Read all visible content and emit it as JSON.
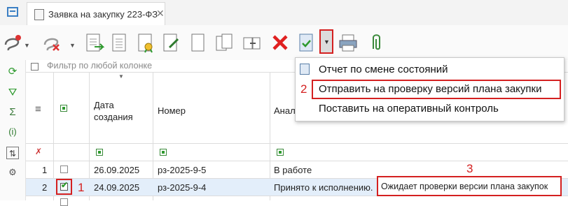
{
  "tab": {
    "title": "Заявка на закупку 223-ФЗ",
    "close": "✕"
  },
  "filter": {
    "placeholder": "Фильтр по любой колонке"
  },
  "columns": {
    "created_line1": "Дата",
    "created_line2": "создания",
    "number": "Номер",
    "analytics": "Анал"
  },
  "rows": [
    {
      "idx": "1",
      "checked": false,
      "date": "26.09.2025",
      "number": "рз-2025-9-5",
      "status": "В работе",
      "state": ""
    },
    {
      "idx": "2",
      "checked": true,
      "date": "24.09.2025",
      "number": "рз-2025-9-4",
      "status": "Принято к исполнению.",
      "state": "Ожидает проверки версии плана закупок"
    }
  ],
  "menu": {
    "items": [
      "Отчет по смене состояний",
      "Отправить на проверку версий плана закупки",
      "Поставить на оперативный контроль"
    ]
  },
  "annotations": {
    "n1": "1",
    "n2": "2",
    "n3": "3"
  },
  "colors": {
    "highlight": "#d42020",
    "selected_row": "#e3eefa",
    "accent_green": "#2e9a2e"
  }
}
